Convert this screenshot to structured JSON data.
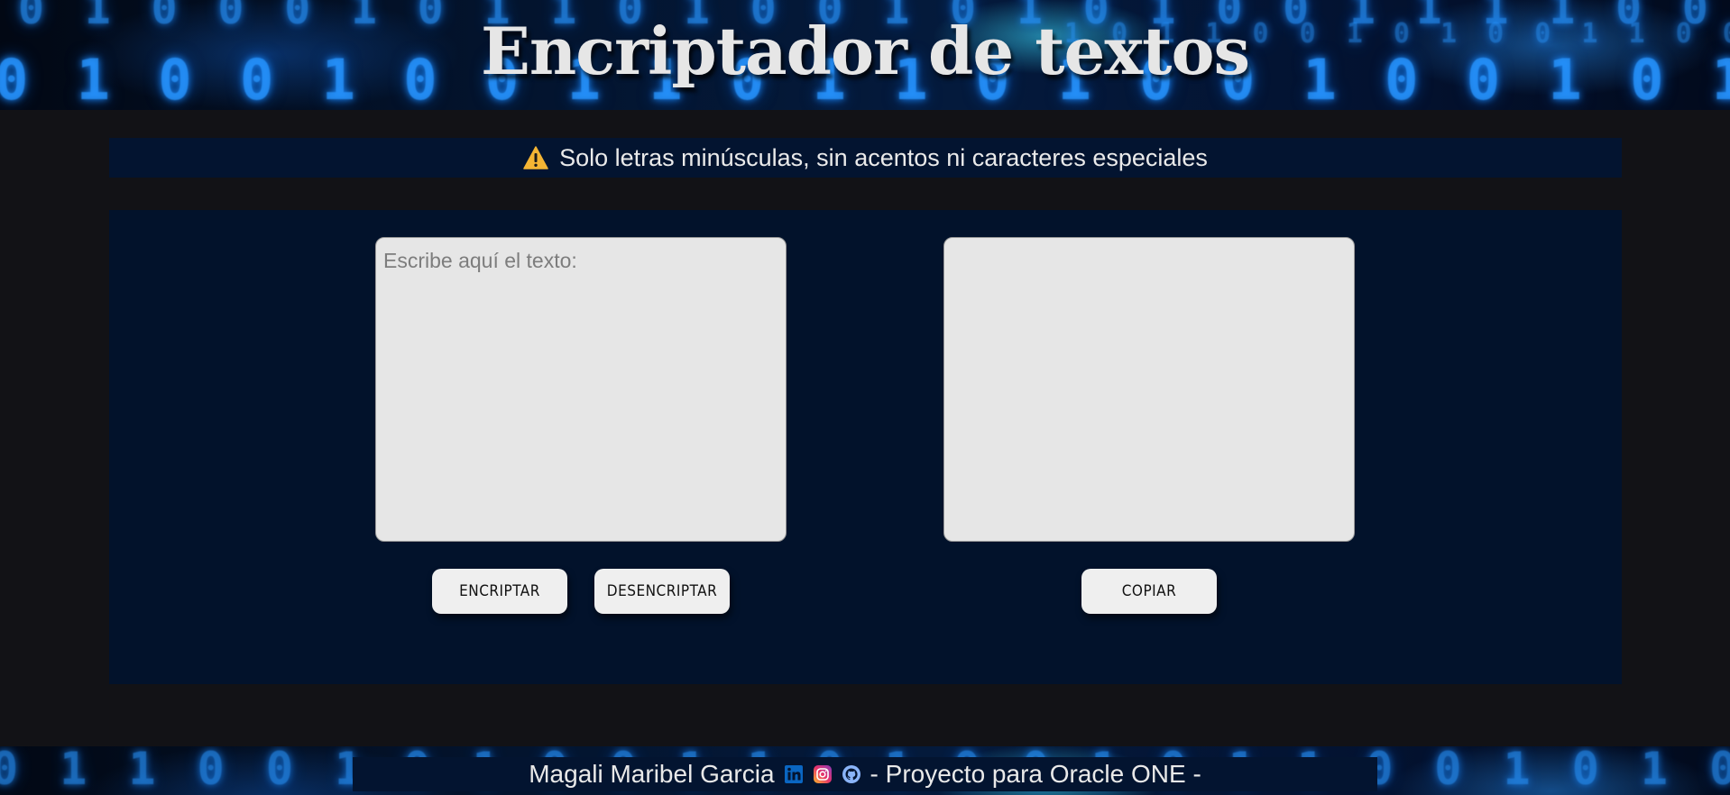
{
  "header": {
    "title": "Encriptador de textos",
    "binary_row_1": "0 1 0 0 0 1 0 1 1 0 1 0 0 1 0 1 0 1 0 0 1 1 1 1 0 0 0 1 0 0 1 0 0 1 1 1 0 0 0 1 0 1 0 0 1 0",
    "binary_row_2": "0 1 0 0 1 0 0 1 1 0 1 1 0 1 0 0 1 0 0 1 0 1 1 0 0 1 0 0 0 0 1 0 1 0 1 1 1 0 0 0 1 0 0 0 0 1 1",
    "binary_row_3": "1 0 1 1 0 0 1 0 1 0 0 1 1 0 0 1 1 0 1 0 0 1 0 0 1 1 0 1 0 1 0 0 1 1 0 1 0 0 1 0 1 0 0 1 1 0 1"
  },
  "warning": {
    "icon": "warning-triangle-icon",
    "text": "Solo letras minúsculas, sin acentos ni caracteres especiales",
    "icon_color": "#f4b534"
  },
  "input": {
    "placeholder": "Escribe aquí el texto:",
    "value": ""
  },
  "output": {
    "value": ""
  },
  "buttons": {
    "encrypt_label": "ENCRIPTAR",
    "decrypt_label": "DESENCRIPTAR",
    "copy_label": "COPIAR"
  },
  "footer": {
    "author": "Magali Maribel Garcia",
    "project": "- Proyecto para Oracle ONE -",
    "social": [
      "linkedin-icon",
      "instagram-icon",
      "github-icon"
    ],
    "binary_row": "0 1 1 0 0 1 0 1 0 0 1 1 0 1 0 0 1 0 1 1 0 0 1 0 1 0 0 1 1 0 0 1 0 1 0 1 1 0 0 1 0 1 0 0 1 1 0 0 1 0 1"
  },
  "colors": {
    "page_background": "#121216",
    "panel_background": "#02122b",
    "bar_background": "#031430",
    "text_light": "#e6e6e6",
    "linkedin": "#0a66c2",
    "github": "#8ab4f8"
  }
}
